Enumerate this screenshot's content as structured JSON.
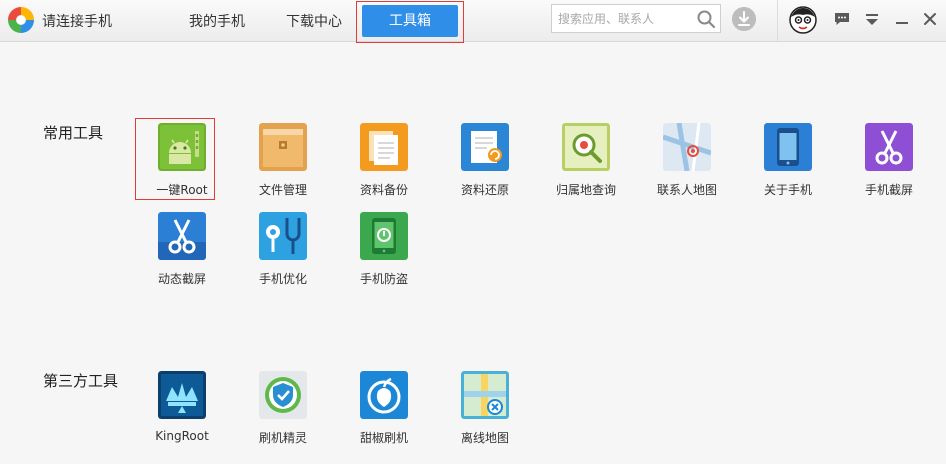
{
  "app": {
    "title": "请连接手机"
  },
  "nav": {
    "tabs": [
      {
        "label": "我的手机"
      },
      {
        "label": "下载中心"
      },
      {
        "label": "工具箱",
        "active": true
      }
    ]
  },
  "search": {
    "placeholder": "搜索应用、联系人",
    "value": ""
  },
  "sections": {
    "common": {
      "title": "常用工具",
      "tools": [
        {
          "label": "一键Root",
          "icon": "android-root-icon",
          "selected": true
        },
        {
          "label": "文件管理",
          "icon": "folder-icon"
        },
        {
          "label": "资料备份",
          "icon": "documents-icon"
        },
        {
          "label": "资料还原",
          "icon": "restore-document-icon"
        },
        {
          "label": "归属地查询",
          "icon": "location-search-icon"
        },
        {
          "label": "联系人地图",
          "icon": "contact-map-icon"
        },
        {
          "label": "关于手机",
          "icon": "phone-icon"
        },
        {
          "label": "手机截屏",
          "icon": "scissors-icon"
        },
        {
          "label": "动态截屏",
          "icon": "scissors-icon"
        },
        {
          "label": "手机优化",
          "icon": "stethoscope-icon"
        },
        {
          "label": "手机防盗",
          "icon": "anti-theft-icon"
        }
      ]
    },
    "third": {
      "title": "第三方工具",
      "tools": [
        {
          "label": "KingRoot",
          "icon": "kingroot-icon"
        },
        {
          "label": "刷机精灵",
          "icon": "shield-icon"
        },
        {
          "label": "甜椒刷机",
          "icon": "pepper-flash-icon"
        },
        {
          "label": "离线地图",
          "icon": "offline-map-icon"
        }
      ]
    }
  },
  "colors": {
    "accent": "#2f8ee8",
    "highlight_border": "#e23b3b"
  }
}
